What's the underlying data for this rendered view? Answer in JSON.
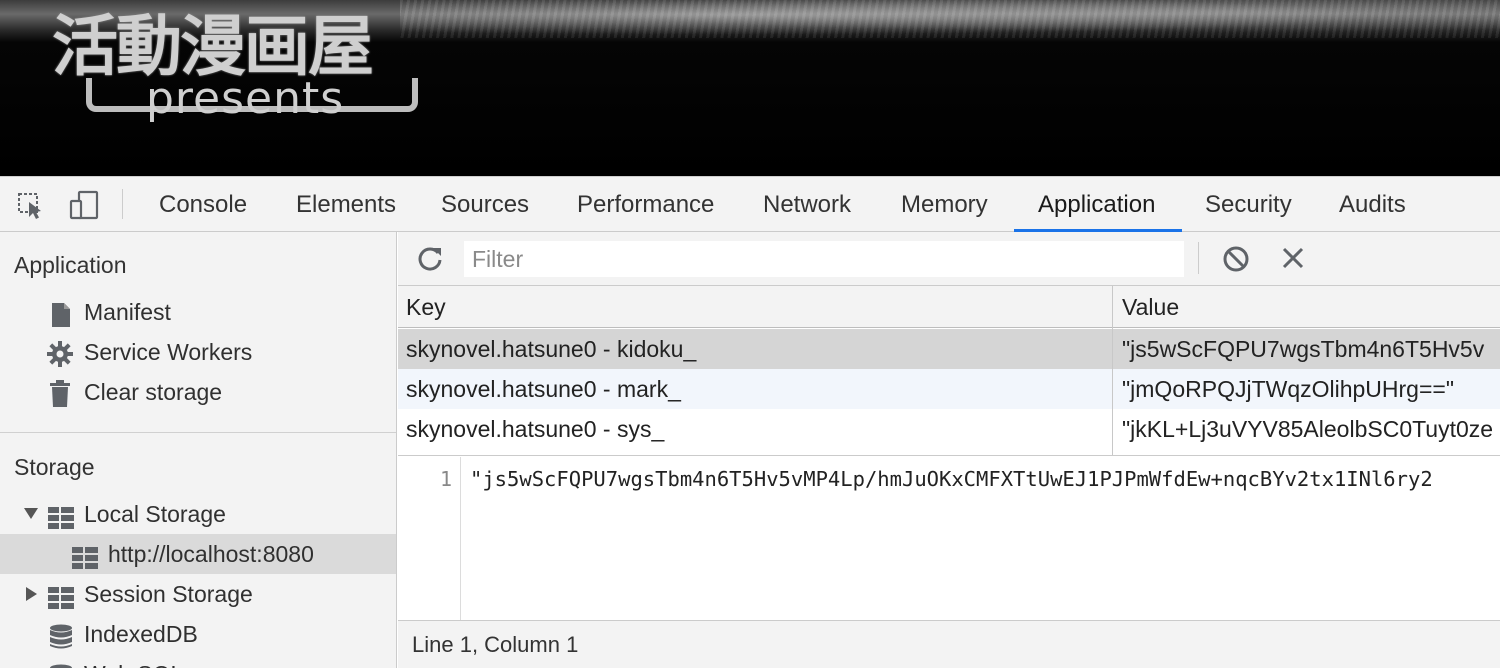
{
  "banner": {
    "logo_title": "活動漫画屋",
    "logo_subtitle": "presents"
  },
  "tabs": [
    {
      "label": "Console"
    },
    {
      "label": "Elements"
    },
    {
      "label": "Sources"
    },
    {
      "label": "Performance"
    },
    {
      "label": "Network"
    },
    {
      "label": "Memory"
    },
    {
      "label": "Application"
    },
    {
      "label": "Security"
    },
    {
      "label": "Audits"
    }
  ],
  "active_tab": "Application",
  "sidebar": {
    "application_header": "Application",
    "application_items": [
      {
        "label": "Manifest",
        "icon": "document-icon"
      },
      {
        "label": "Service Workers",
        "icon": "gear-icon"
      },
      {
        "label": "Clear storage",
        "icon": "trash-icon"
      }
    ],
    "storage_header": "Storage",
    "storage_items": [
      {
        "label": "Local Storage",
        "icon": "grid-icon",
        "expanded": true
      },
      {
        "label": "http://localhost:8080",
        "icon": "grid-icon",
        "selected": true
      },
      {
        "label": "Session Storage",
        "icon": "grid-icon",
        "expanded": false
      },
      {
        "label": "IndexedDB",
        "icon": "database-icon"
      },
      {
        "label": "Web SQL",
        "icon": "database-icon"
      }
    ]
  },
  "toolbar": {
    "filter_placeholder": "Filter"
  },
  "table": {
    "headers": [
      "Key",
      "Value"
    ],
    "rows": [
      {
        "key": "skynovel.hatsune0 - kidoku_",
        "value": "\"js5wScFQPU7wgsTbm4n6T5Hv5v"
      },
      {
        "key": "skynovel.hatsune0 - mark_",
        "value": "\"jmQoRPQJjTWqzOlihpUHrg==\""
      },
      {
        "key": "skynovel.hatsune0 - sys_",
        "value": "\"jkKL+Lj3uVYV85AleolbSC0Tuyt0ze"
      }
    ]
  },
  "preview": {
    "line_number": "1",
    "code": "\"js5wScFQPU7wgsTbm4n6T5Hv5vMP4Lp/hmJuOKxCMFXTtUwEJ1PJPmWfdEw+nqcBYv2tx1INl6ry2"
  },
  "status": "Line 1, Column 1",
  "colors": {
    "accent": "#1a73e8",
    "panel_bg": "#f3f3f3",
    "selected_row": "#d5d5d5"
  }
}
